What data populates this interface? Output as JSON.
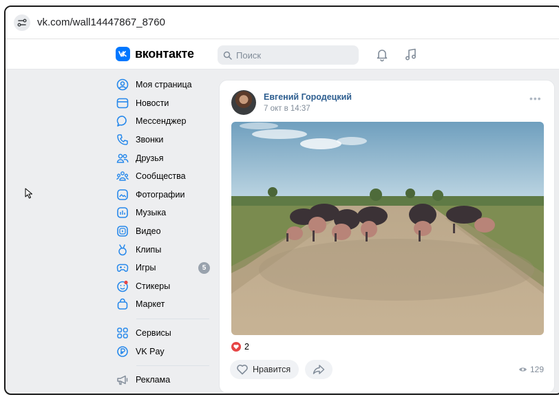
{
  "browser": {
    "url": "vk.com/wall14447867_8760"
  },
  "header": {
    "logo_text": "вконтакте",
    "search_placeholder": "Поиск"
  },
  "sidebar": {
    "items": [
      {
        "label": "Моя страница",
        "icon": "user-circle-icon"
      },
      {
        "label": "Новости",
        "icon": "news-icon"
      },
      {
        "label": "Мессенджер",
        "icon": "message-icon"
      },
      {
        "label": "Звонки",
        "icon": "phone-icon"
      },
      {
        "label": "Друзья",
        "icon": "friends-icon"
      },
      {
        "label": "Сообщества",
        "icon": "communities-icon"
      },
      {
        "label": "Фотографии",
        "icon": "photo-icon"
      },
      {
        "label": "Музыка",
        "icon": "music-icon"
      },
      {
        "label": "Видео",
        "icon": "video-icon"
      },
      {
        "label": "Клипы",
        "icon": "clips-icon"
      },
      {
        "label": "Игры",
        "icon": "gamepad-icon",
        "badge": "5"
      },
      {
        "label": "Стикеры",
        "icon": "sticker-icon"
      },
      {
        "label": "Маркет",
        "icon": "market-bag-icon"
      }
    ],
    "services": [
      {
        "label": "Сервисы",
        "icon": "grid-icon"
      },
      {
        "label": "VK Pay",
        "icon": "vkpay-icon"
      }
    ],
    "ads": [
      {
        "label": "Реклама",
        "icon": "megaphone-icon"
      }
    ]
  },
  "post": {
    "author": "Евгений Городецкий",
    "date": "7 окт в 14:37",
    "reactions_count": "2",
    "like_label": "Нравится",
    "views": "129"
  },
  "colors": {
    "accent": "#0077ff",
    "link": "#2c5d8f",
    "icon": "#2688eb",
    "reaction": "#e64646"
  }
}
